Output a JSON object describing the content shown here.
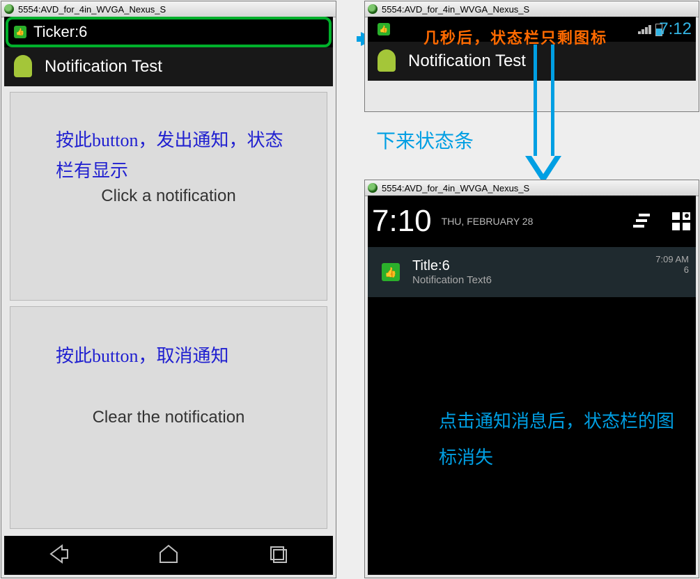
{
  "left": {
    "window_title": "5554:AVD_for_4in_WVGA_Nexus_S",
    "ticker": "Ticker:6",
    "app_title": "Notification Test",
    "btn1_label": "Click a notification",
    "btn2_label": "Clear the notification",
    "note1": "按此button，发出通知，状态栏有显示",
    "note2": "按此button，取消通知"
  },
  "right_top": {
    "window_title": "5554:AVD_for_4in_WVGA_Nexus_S",
    "app_title": "Notification Test",
    "clock": "7:12",
    "note_orange": "几秒后，状态栏只剩图标"
  },
  "mid_note": "下来状态条",
  "right_bottom": {
    "window_title": "5554:AVD_for_4in_WVGA_Nexus_S",
    "big_time": "7:10",
    "date": "THU, FEBRUARY 28",
    "notif_title": "Title:6",
    "notif_text": "Notification Text6",
    "notif_time": "7:09 AM",
    "notif_count": "6",
    "note_cyan": "点击通知消息后，状态栏的图标消失"
  }
}
